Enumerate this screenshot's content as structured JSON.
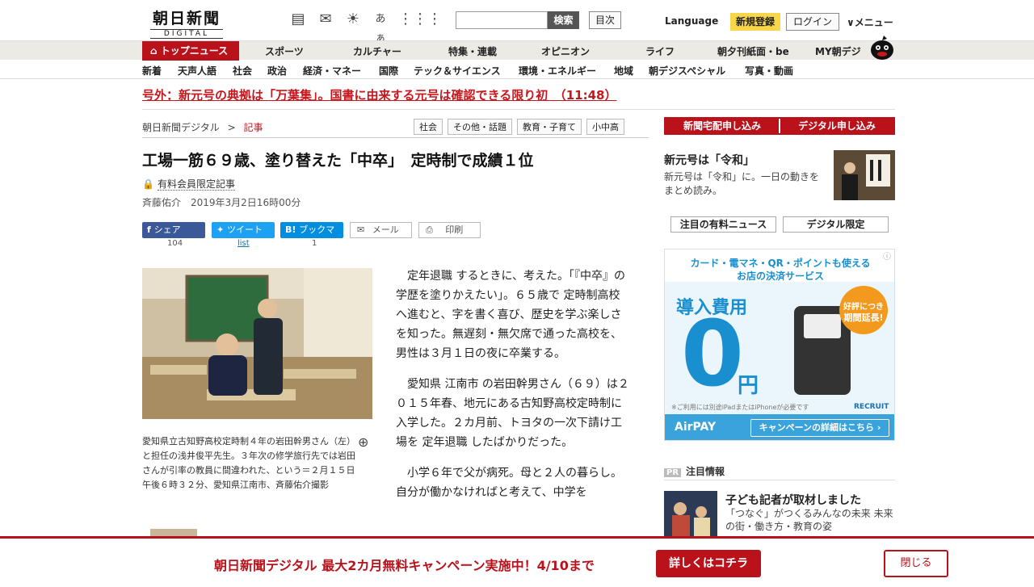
{
  "header": {
    "logo_ja": "朝日新聞",
    "logo_en": "DIGITAL",
    "icons": [
      "tablet-icon",
      "newspaper-icon",
      "weather-icon",
      "font-size-icon",
      "grid-icon"
    ],
    "font_size_label": "あぁ",
    "search_placeholder": "",
    "search_button": "検索",
    "contents_button": "目次",
    "language": "Language",
    "signup": "新規登録",
    "login": "ログイン",
    "menu": "∨メニュー"
  },
  "nav_primary": {
    "top": "トップニュース",
    "items": [
      "スポーツ",
      "カルチャー",
      "特集・連載",
      "オピニオン",
      "ライフ",
      "朝夕刊紙面・be",
      "MY朝デジ"
    ]
  },
  "nav_secondary": {
    "items": [
      "新着",
      "天声人語",
      "社会",
      "政治",
      "経済・マネー",
      "国際",
      "テック＆サイエンス",
      "環境・エネルギー",
      "地域",
      "朝デジスペシャル",
      "写真・動画"
    ]
  },
  "breaking": "号外：新元号の典拠は「万葉集」。国書に由来する元号は確認できる限り初　（11:48）",
  "breadcrumb": {
    "home": "朝日新聞デジタル",
    "sep": ">",
    "current": "記事"
  },
  "tags": [
    "社会",
    "その他・話題",
    "教育・子育て",
    "小中高"
  ],
  "article": {
    "title": "工場一筋６９歳、塗り替えた「中卒」　定時制で成績１位",
    "member": "有料会員限定記事",
    "byline": "斉藤佑介　2019年3月2日16時00分",
    "share": {
      "facebook": "シェア",
      "facebook_count": "104",
      "twitter": "ツイート",
      "twitter_count": "list",
      "hatena": "ブックマーク",
      "hatena_count": "1",
      "mail": "メール",
      "print": "印刷"
    },
    "caption": "愛知県立古知野高校定時制４年の岩田幹男さん（左）と担任の浅井俊平先生。３年次の修学旅行先では岩田さんが引率の教員に間違われた、という＝２月１５日午後６時３２分、愛知県江南市、斉藤佑介撮影",
    "paragraphs": [
      "定年退職 するときに、考えた。「『中卒』の学歴を塗りかえたい」。６５歳で 定時制高校 へ進むと、字を書く喜び、歴史を学ぶ楽しさを知った。無遅刻・無欠席で通った高校を、男性は３月１日の夜に卒業する。",
      "愛知県 江南市 の岩田幹男さん（６９）は２０１５年春、地元にある古知野高校定時制に入学した。２カ月前、トヨタの一次下請け工場を 定年退職 したばかりだった。",
      "小学６年で父が病死。母と２人の暮らし。自分が働かなければと考えて、中学を"
    ]
  },
  "right": {
    "btn_home": "新聞宅配申し込み",
    "btn_digital": "デジタル申し込み",
    "reiwa_title": "新元号は「令和」",
    "reiwa_desc": "新元号は「令和」に。一日の動きをまとめ読み。",
    "tab_paid": "注目の有料ニュース",
    "tab_digital": "デジタル限定",
    "ad": {
      "line1": "カード・電マネ・QR・ポイントも使える",
      "line2": "お店の決済サービス",
      "fee": "導入費用",
      "zero": "0",
      "yen": "円",
      "badge1": "好評につき",
      "badge2": "期間延長!",
      "note": "※ご利用には別途iPadまたはiPhoneが必要です",
      "brand": "AirPAY",
      "cta": "キャンペーンの詳細はこちら ›",
      "recruit": "RECRUIT"
    },
    "pr_badge": "PR",
    "pr_label": "注目情報",
    "pr_title": "子ども記者が取材しました",
    "pr_desc": "「つなぐ」がつくるみんなの未来 未来の街・働き方・教育の姿"
  },
  "banner": {
    "message": "朝日新聞デジタル 最大2カ月無料キャンペーン実施中！4/10まで",
    "more": "詳しくはコチラ",
    "close": "閉じる"
  },
  "colors": {
    "brand_red": "#b9121b",
    "nav_bg": "#eceae4",
    "signup_yellow": "#f8d64a"
  }
}
